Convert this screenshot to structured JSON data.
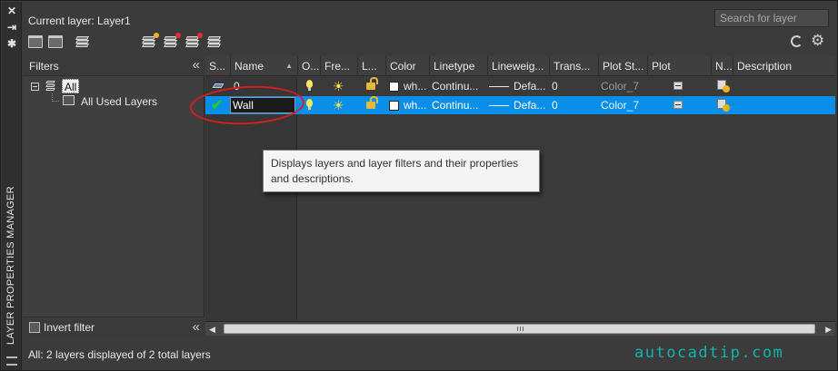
{
  "panel": {
    "side_title": "LAYER PROPERTIES MANAGER",
    "current_layer": "Current layer: Layer1",
    "search_placeholder": "Search for layer"
  },
  "filters": {
    "header": "Filters",
    "tree": {
      "root": "All",
      "child": "All Used Layers"
    },
    "invert_filter_label": "Invert filter"
  },
  "grid": {
    "columns": [
      "S...",
      "Name",
      "O...",
      "Fre...",
      "L...",
      "Color",
      "Linetype",
      "Lineweig...",
      "Trans...",
      "Plot St...",
      "Plot",
      "N...",
      "Description"
    ],
    "rows": [
      {
        "status": "layer",
        "name": "0",
        "color": "wh...",
        "linetype": "Continu...",
        "lineweight": "Defa...",
        "transparency": "0",
        "plot_style": "Color_7",
        "selected": false
      },
      {
        "status": "current",
        "name": "Wall",
        "color": "wh...",
        "linetype": "Continu...",
        "lineweight": "Defa...",
        "transparency": "0",
        "plot_style": "Color_7",
        "selected": true
      }
    ]
  },
  "tooltip": "Displays layers and layer filters and their properties and descriptions.",
  "status_bar": "All: 2 layers displayed of 2 total layers",
  "watermark": "autocadtip.com",
  "colors": {
    "selection": "#0a8fe8",
    "annotation": "#d21f1f",
    "watermark": "#12b3b0",
    "background": "#3b3b3b"
  }
}
